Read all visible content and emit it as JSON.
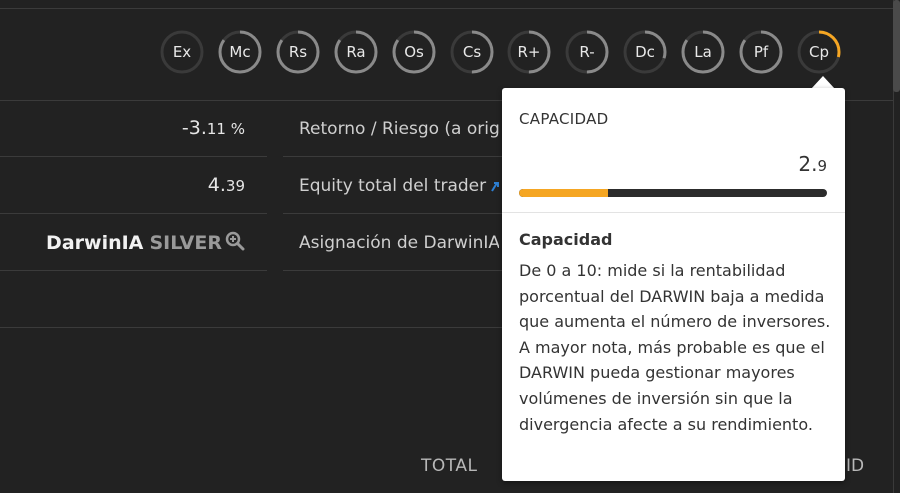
{
  "scores": [
    {
      "label": "Ex",
      "level": 0.0,
      "color": "#555555"
    },
    {
      "label": "Mc",
      "level": 0.85,
      "color": "#8a8a8a"
    },
    {
      "label": "Rs",
      "level": 0.85,
      "color": "#8a8a8a"
    },
    {
      "label": "Ra",
      "level": 0.85,
      "color": "#8a8a8a"
    },
    {
      "label": "Os",
      "level": 0.85,
      "color": "#8a8a8a"
    },
    {
      "label": "Cs",
      "level": 0.5,
      "color": "#8a8a8a"
    },
    {
      "label": "R+",
      "level": 0.5,
      "color": "#8a8a8a"
    },
    {
      "label": "R-",
      "level": 0.5,
      "color": "#8a8a8a"
    },
    {
      "label": "Dc",
      "level": 0.3,
      "color": "#8a8a8a"
    },
    {
      "label": "La",
      "level": 0.85,
      "color": "#8a8a8a"
    },
    {
      "label": "Pf",
      "level": 0.85,
      "color": "#8a8a8a"
    },
    {
      "label": "Cp",
      "level": 0.29,
      "color": "#f5a623"
    }
  ],
  "stats": {
    "return_risk_value_main": "-3.",
    "return_risk_value_small": "11 %",
    "return_risk_label": "Retorno / Riesgo (a origen)",
    "equity_value_main": "4.",
    "equity_value_small": "39",
    "equity_label": "Equity total del trader",
    "darwinia_name": "DarwinIA",
    "darwinia_tier": "SILVER",
    "allocation_label": "Asignación de DarwinIA"
  },
  "footer": {
    "total_label": "TOTAL",
    "right_label": "ID"
  },
  "tooltip": {
    "title": "CAPACIDAD",
    "value_main": "2.",
    "value_small": "9",
    "level": 0.29,
    "heading": "Capacidad",
    "description": "De 0 a 10: mide si la rentabilidad porcentual del DARWIN baja a medida que aumenta el número de inversores. A mayor nota, más probable es que el DARWIN pueda gestionar mayores volúmenes de inversión sin que la divergencia afecte a su rendimiento."
  },
  "colors": {
    "accent": "#f5a623",
    "link": "#2d7fd3",
    "background": "#222222"
  }
}
